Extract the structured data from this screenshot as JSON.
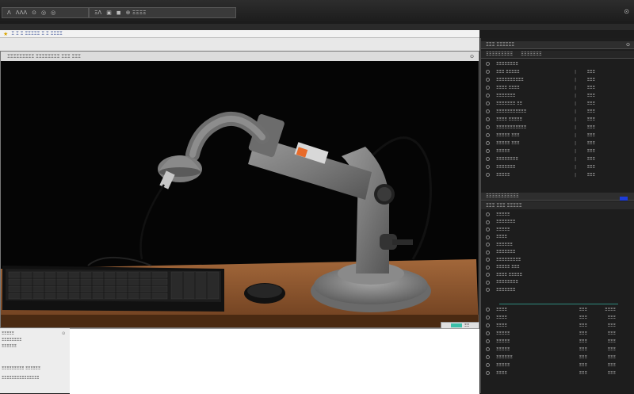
{
  "toolbar": {
    "group1": [
      "Λ",
      "ΛΛΛ",
      "⊙",
      "◎",
      "◎"
    ],
    "group2": [
      "ΞΛ",
      "▣",
      "◼",
      "⊕ ΞΞΞΞ"
    ],
    "right_icon": "⊙"
  },
  "address_bar": {
    "text": "Ξ Ξ Ξ ΞΞΞΞΞ Ξ Ξ ΞΞΞΞ"
  },
  "viewport": {
    "header_text": "ΞΞΞΞΞΞΞΞΞ ΞΞΞΞΞΞΞΞ ΞΞΞ ΞΞΞ",
    "header_right": "⊙",
    "status": "ΞΞ"
  },
  "bottom_left": {
    "rows": [
      "ΞΞΞΞΞ",
      "ΞΞΞΞΞΞΞΞ",
      "ΞΞΞΞΞΞ",
      "ΞΞΞΞΞΞΞΞΞ ΞΞΞΞΞΞ",
      "ΞΞΞΞΞΞΞΞΞΞΞΞΞΞΞ"
    ]
  },
  "right_panel": {
    "header1": [
      "ΞΞΞ ΞΞΞΞΞΞ",
      "⊙"
    ],
    "header1b": [
      "ΞΞΞΞΞΞΞΞΞ",
      "ΞΞΞΞΞΞΞ"
    ],
    "list1": [
      {
        "name": "ΞΞΞΞΞΞΞΞ",
        "v1": "",
        "v2": ""
      },
      {
        "name": "ΞΞΞ ΞΞΞΞΞ",
        "v1": "|",
        "v2": "ΞΞΞ"
      },
      {
        "name": "ΞΞΞΞΞΞΞΞΞΞ",
        "v1": "|",
        "v2": "ΞΞΞ"
      },
      {
        "name": "ΞΞΞΞ ΞΞΞΞ",
        "v1": "|",
        "v2": "ΞΞΞ"
      },
      {
        "name": "ΞΞΞΞΞΞΞ",
        "v1": "|",
        "v2": "ΞΞΞ"
      },
      {
        "name": "ΞΞΞΞΞΞΞ ΞΞ",
        "v1": "|",
        "v2": "ΞΞΞ"
      },
      {
        "name": "ΞΞΞΞΞΞΞΞΞΞΞ",
        "v1": "|",
        "v2": "ΞΞΞ"
      },
      {
        "name": "ΞΞΞΞ ΞΞΞΞΞ",
        "v1": "|",
        "v2": "ΞΞΞ"
      },
      {
        "name": "ΞΞΞΞΞΞΞΞΞΞΞ",
        "v1": "|",
        "v2": "ΞΞΞ"
      },
      {
        "name": "ΞΞΞΞΞ ΞΞΞ",
        "v1": "|",
        "v2": "ΞΞΞ"
      },
      {
        "name": "ΞΞΞΞΞ ΞΞΞ",
        "v1": "|",
        "v2": "ΞΞΞ"
      },
      {
        "name": "ΞΞΞΞΞ",
        "v1": "|",
        "v2": "ΞΞΞ"
      },
      {
        "name": "ΞΞΞΞΞΞΞΞ",
        "v1": "|",
        "v2": "ΞΞΞ"
      },
      {
        "name": "ΞΞΞΞΞΞΞ",
        "v1": "|",
        "v2": "ΞΞΞ"
      },
      {
        "name": "ΞΞΞΞΞ",
        "v1": "|",
        "v2": "ΞΞΞ"
      }
    ],
    "header2": "ΞΞΞΞΞΞΞΞΞΞΞ",
    "header2b": "ΞΞΞ ΞΞΞ ΞΞΞΞΞ",
    "list2": [
      {
        "name": "ΞΞΞΞΞ"
      },
      {
        "name": "ΞΞΞΞΞΞΞ"
      },
      {
        "name": "ΞΞΞΞΞ"
      },
      {
        "name": "ΞΞΞΞ"
      },
      {
        "name": "ΞΞΞΞΞΞ"
      },
      {
        "name": "ΞΞΞΞΞΞΞ"
      },
      {
        "name": "ΞΞΞΞΞΞΞΞΞ"
      },
      {
        "name": "ΞΞΞΞΞ ΞΞΞ"
      },
      {
        "name": "ΞΞΞΞ ΞΞΞΞΞ"
      },
      {
        "name": "ΞΞΞΞΞΞΞΞ"
      },
      {
        "name": "ΞΞΞΞΞΞΞ"
      }
    ],
    "list3": [
      {
        "name": "ΞΞΞΞ",
        "v2": "ΞΞΞ",
        "v3": "ΞΞΞΞ"
      },
      {
        "name": "ΞΞΞΞ",
        "v2": "ΞΞΞ",
        "v3": "ΞΞΞ"
      },
      {
        "name": "ΞΞΞΞ",
        "v2": "ΞΞΞ",
        "v3": "ΞΞΞ"
      },
      {
        "name": "ΞΞΞΞΞ",
        "v2": "ΞΞΞ",
        "v3": "ΞΞΞ"
      },
      {
        "name": "ΞΞΞΞΞ",
        "v2": "ΞΞΞ",
        "v3": "ΞΞΞ"
      },
      {
        "name": "ΞΞΞΞΞ",
        "v2": "ΞΞΞ",
        "v3": "ΞΞΞ"
      },
      {
        "name": "ΞΞΞΞΞΞ",
        "v2": "ΞΞΞ",
        "v3": "ΞΞΞ"
      },
      {
        "name": "ΞΞΞΞΞ",
        "v2": "ΞΞΞ",
        "v3": "ΞΞΞ"
      },
      {
        "name": "ΞΞΞΞ",
        "v2": "ΞΞΞ",
        "v3": "ΞΞΞ"
      }
    ]
  }
}
